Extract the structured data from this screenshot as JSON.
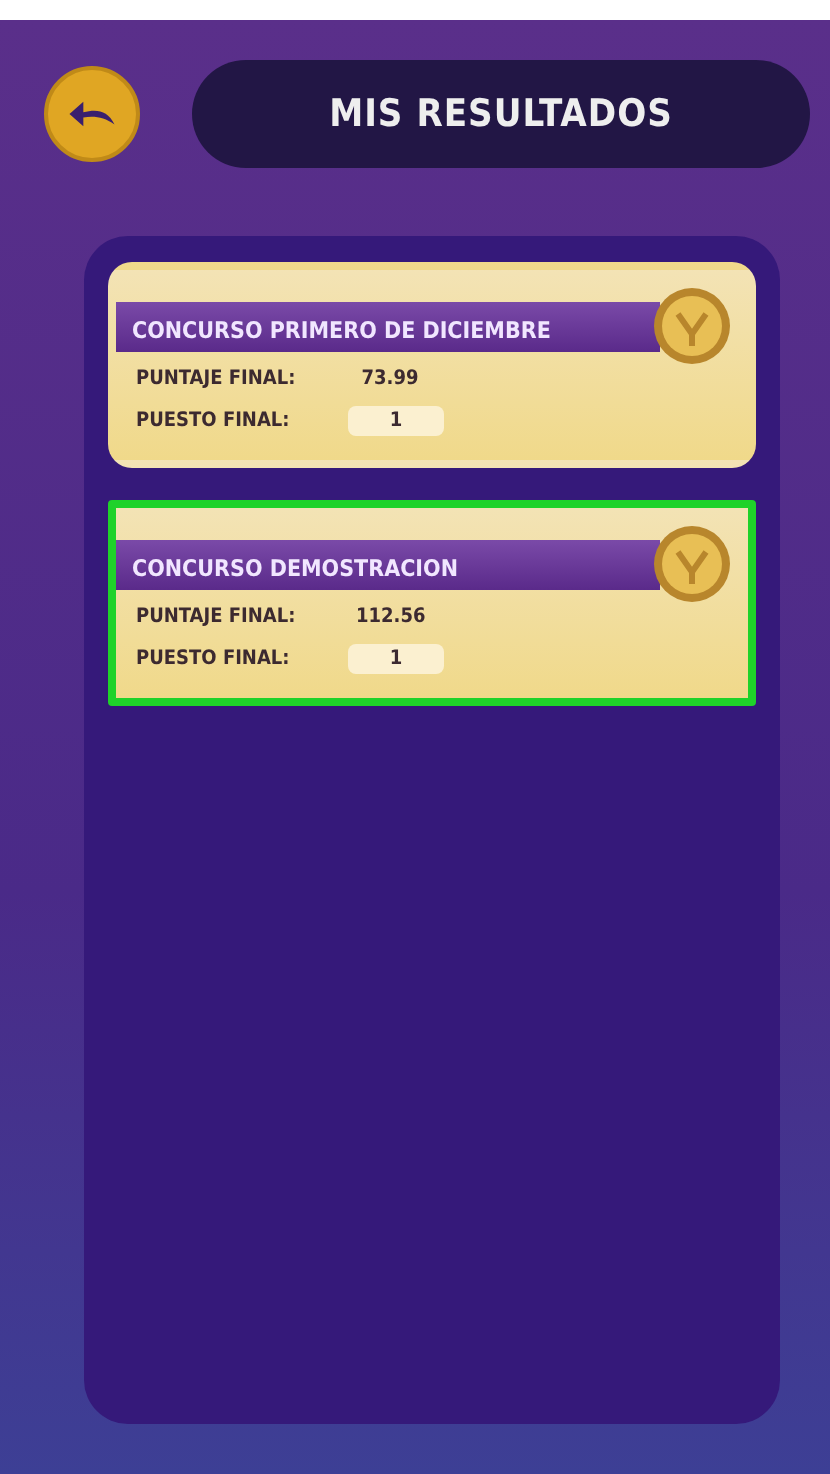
{
  "header": {
    "title": "MIS RESULTADOS"
  },
  "results": [
    {
      "contest": "CONCURSO PRIMERO DE DICIEMBRE",
      "score_label": "PUNTAJE FINAL:",
      "score": "73.99",
      "rank_label": "PUESTO FINAL:",
      "rank": "1",
      "selected": false
    },
    {
      "contest": "CONCURSO DEMOSTRACION",
      "score_label": "PUNTAJE FINAL:",
      "score": "112.56",
      "rank_label": "PUESTO FINAL:",
      "rank": "1",
      "selected": true
    }
  ]
}
